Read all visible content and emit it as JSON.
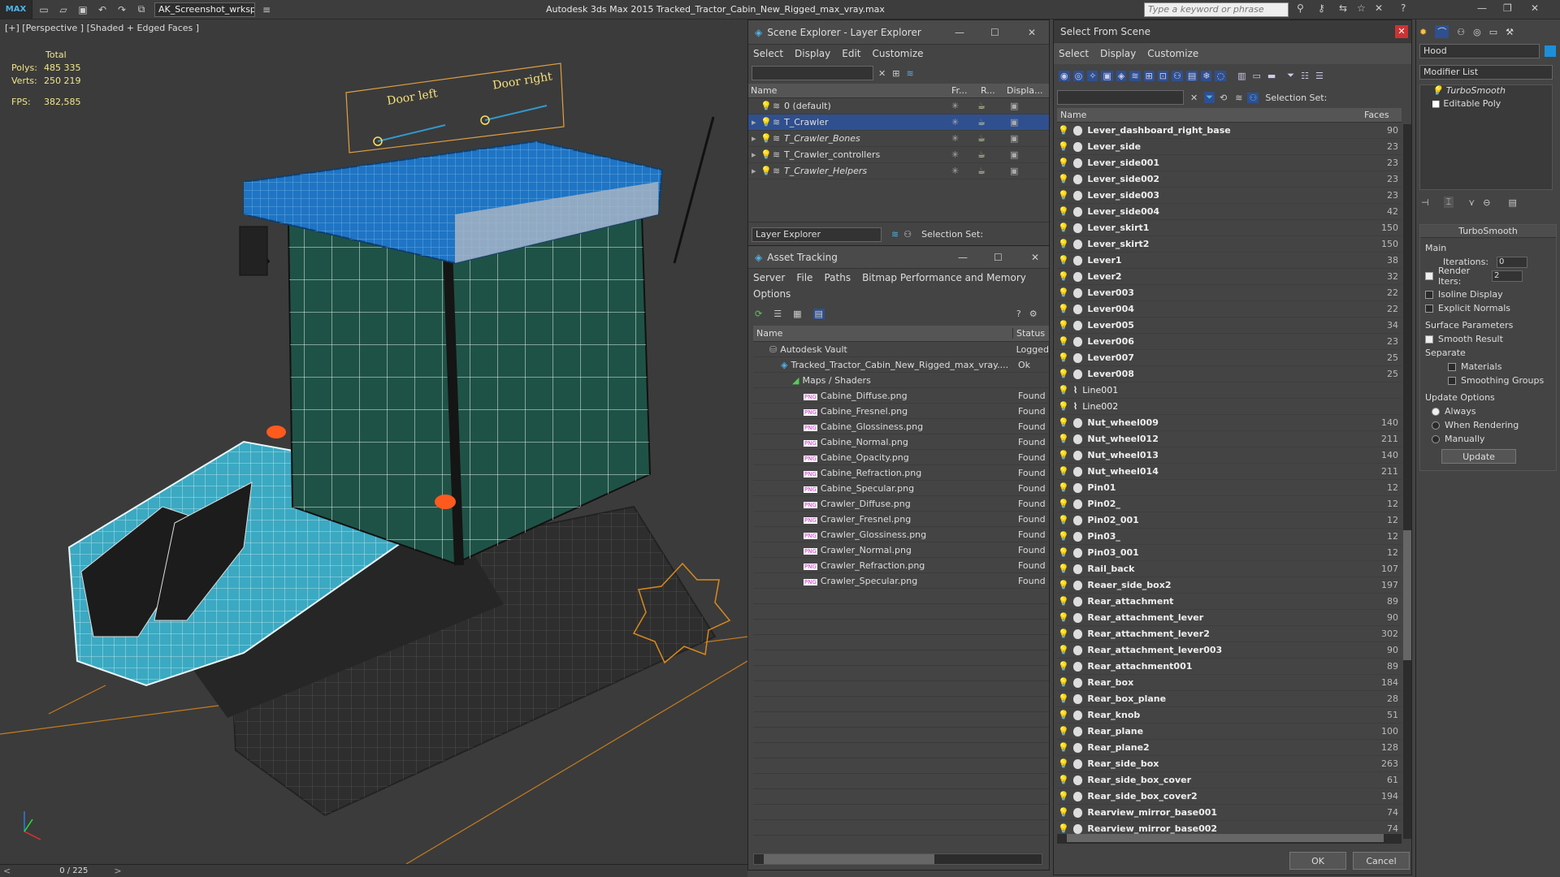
{
  "app": {
    "logo": "MAX",
    "workspace": "AK_Screenshot_wrksp",
    "title": "Autodesk 3ds Max  2015     Tracked_Tractor_Cabin_New_Rigged_max_vray.max",
    "search_placeholder": "Type a keyword or phrase"
  },
  "viewport": {
    "label": "[+] [Perspective ] [Shaded + Edged Faces ]",
    "stats_total": "Total",
    "polys_label": "Polys:",
    "polys_value": "485 335",
    "verts_label": "Verts:",
    "verts_value": "250 219",
    "fps_label": "FPS:",
    "fps_value": "382,585",
    "door_left": "Door left",
    "door_right": "Door right",
    "timeline": "0 / 225"
  },
  "scene_explorer": {
    "title": "Scene Explorer - Layer Explorer",
    "menu": [
      "Select",
      "Display",
      "Edit",
      "Customize"
    ],
    "columns": [
      "Name",
      "Fr...",
      "R...",
      "Displa..."
    ],
    "rows": [
      {
        "name": "0 (default)",
        "selected": false,
        "italic": false
      },
      {
        "name": "T_Crawler",
        "selected": true,
        "italic": false
      },
      {
        "name": "T_Crawler_Bones",
        "selected": false,
        "italic": true
      },
      {
        "name": "T_Crawler_controllers",
        "selected": false,
        "italic": false
      },
      {
        "name": "T_Crawler_Helpers",
        "selected": false,
        "italic": true
      }
    ],
    "footer_dropdown": "Layer Explorer",
    "selection_set": "Selection Set:"
  },
  "asset_tracking": {
    "title": "Asset Tracking",
    "menu": [
      "Server",
      "File",
      "Paths",
      "Bitmap Performance and Memory"
    ],
    "menu2": "Options",
    "columns": [
      "Name",
      "Status"
    ],
    "rows": [
      {
        "name": "Autodesk Vault",
        "status": "Logged",
        "indent": 1
      },
      {
        "name": "Tracked_Tractor_Cabin_New_Rigged_max_vray....",
        "status": "Ok",
        "indent": 2
      },
      {
        "name": "Maps / Shaders",
        "status": "",
        "indent": 3
      },
      {
        "name": "Cabine_Diffuse.png",
        "status": "Found",
        "indent": 4
      },
      {
        "name": "Cabine_Fresnel.png",
        "status": "Found",
        "indent": 4
      },
      {
        "name": "Cabine_Glossiness.png",
        "status": "Found",
        "indent": 4
      },
      {
        "name": "Cabine_Normal.png",
        "status": "Found",
        "indent": 4
      },
      {
        "name": "Cabine_Opacity.png",
        "status": "Found",
        "indent": 4
      },
      {
        "name": "Cabine_Refraction.png",
        "status": "Found",
        "indent": 4
      },
      {
        "name": "Cabine_Specular.png",
        "status": "Found",
        "indent": 4
      },
      {
        "name": "Crawler_Diffuse.png",
        "status": "Found",
        "indent": 4
      },
      {
        "name": "Crawler_Fresnel.png",
        "status": "Found",
        "indent": 4
      },
      {
        "name": "Crawler_Glossiness.png",
        "status": "Found",
        "indent": 4
      },
      {
        "name": "Crawler_Normal.png",
        "status": "Found",
        "indent": 4
      },
      {
        "name": "Crawler_Refraction.png",
        "status": "Found",
        "indent": 4
      },
      {
        "name": "Crawler_Specular.png",
        "status": "Found",
        "indent": 4
      }
    ]
  },
  "select_from_scene": {
    "title": "Select From Scene",
    "menu": [
      "Select",
      "Display",
      "Customize"
    ],
    "selection_set": "Selection Set:",
    "columns": [
      "Name",
      "Faces"
    ],
    "ok": "OK",
    "cancel": "Cancel",
    "rows": [
      {
        "name": "Lever_dashboard_right_base",
        "faces": "90"
      },
      {
        "name": "Lever_side",
        "faces": "23"
      },
      {
        "name": "Lever_side001",
        "faces": "23"
      },
      {
        "name": "Lever_side002",
        "faces": "23"
      },
      {
        "name": "Lever_side003",
        "faces": "23"
      },
      {
        "name": "Lever_side004",
        "faces": "42"
      },
      {
        "name": "Lever_skirt1",
        "faces": "150"
      },
      {
        "name": "Lever_skirt2",
        "faces": "150"
      },
      {
        "name": "Lever1",
        "faces": "38"
      },
      {
        "name": "Lever2",
        "faces": "32"
      },
      {
        "name": "Lever003",
        "faces": "22"
      },
      {
        "name": "Lever004",
        "faces": "22"
      },
      {
        "name": "Lever005",
        "faces": "34"
      },
      {
        "name": "Lever006",
        "faces": "23"
      },
      {
        "name": "Lever007",
        "faces": "25"
      },
      {
        "name": "Lever008",
        "faces": "25"
      },
      {
        "name": "Line001",
        "faces": ""
      },
      {
        "name": "Line002",
        "faces": ""
      },
      {
        "name": "Nut_wheel009",
        "faces": "140"
      },
      {
        "name": "Nut_wheel012",
        "faces": "211"
      },
      {
        "name": "Nut_wheel013",
        "faces": "140"
      },
      {
        "name": "Nut_wheel014",
        "faces": "211"
      },
      {
        "name": "Pin01",
        "faces": "12"
      },
      {
        "name": "Pin02_",
        "faces": "12"
      },
      {
        "name": "Pin02_001",
        "faces": "12"
      },
      {
        "name": "Pin03_",
        "faces": "12"
      },
      {
        "name": "Pin03_001",
        "faces": "12"
      },
      {
        "name": "Rail_back",
        "faces": "107"
      },
      {
        "name": "Reaer_side_box2",
        "faces": "197"
      },
      {
        "name": "Rear_attachment",
        "faces": "89"
      },
      {
        "name": "Rear_attachment_lever",
        "faces": "90"
      },
      {
        "name": "Rear_attachment_lever2",
        "faces": "302"
      },
      {
        "name": "Rear_attachment_lever003",
        "faces": "90"
      },
      {
        "name": "Rear_attachment001",
        "faces": "89"
      },
      {
        "name": "Rear_box",
        "faces": "184"
      },
      {
        "name": "Rear_box_plane",
        "faces": "28"
      },
      {
        "name": "Rear_knob",
        "faces": "51"
      },
      {
        "name": "Rear_plane",
        "faces": "100"
      },
      {
        "name": "Rear_plane2",
        "faces": "128"
      },
      {
        "name": "Rear_side_box",
        "faces": "263"
      },
      {
        "name": "Rear_side_box_cover",
        "faces": "61"
      },
      {
        "name": "Rear_side_box_cover2",
        "faces": "194"
      },
      {
        "name": "Rearview_mirror_base001",
        "faces": "74"
      },
      {
        "name": "Rearview_mirror_base002",
        "faces": "74"
      }
    ]
  },
  "command_panel": {
    "object_name": "Hood",
    "modifier_list": "Modifier List",
    "stack": [
      "TurboSmooth",
      "Editable Poly"
    ],
    "rollout_title": "TurboSmooth",
    "main_label": "Main",
    "iterations_label": "Iterations:",
    "iterations_value": "0",
    "render_iters_label": "Render Iters:",
    "render_iters_value": "2",
    "isoline": "Isoline Display",
    "explicit": "Explicit Normals",
    "surface_params": "Surface Parameters",
    "smooth_result": "Smooth Result",
    "separate": "Separate",
    "materials": "Materials",
    "smoothing_groups": "Smoothing Groups",
    "update_options": "Update Options",
    "always": "Always",
    "when_rendering": "When Rendering",
    "manually": "Manually",
    "update_button": "Update"
  },
  "colors": {
    "selection": "#2f4f8f",
    "bulb": "#ffd84a",
    "stats": "#f0e68c"
  }
}
